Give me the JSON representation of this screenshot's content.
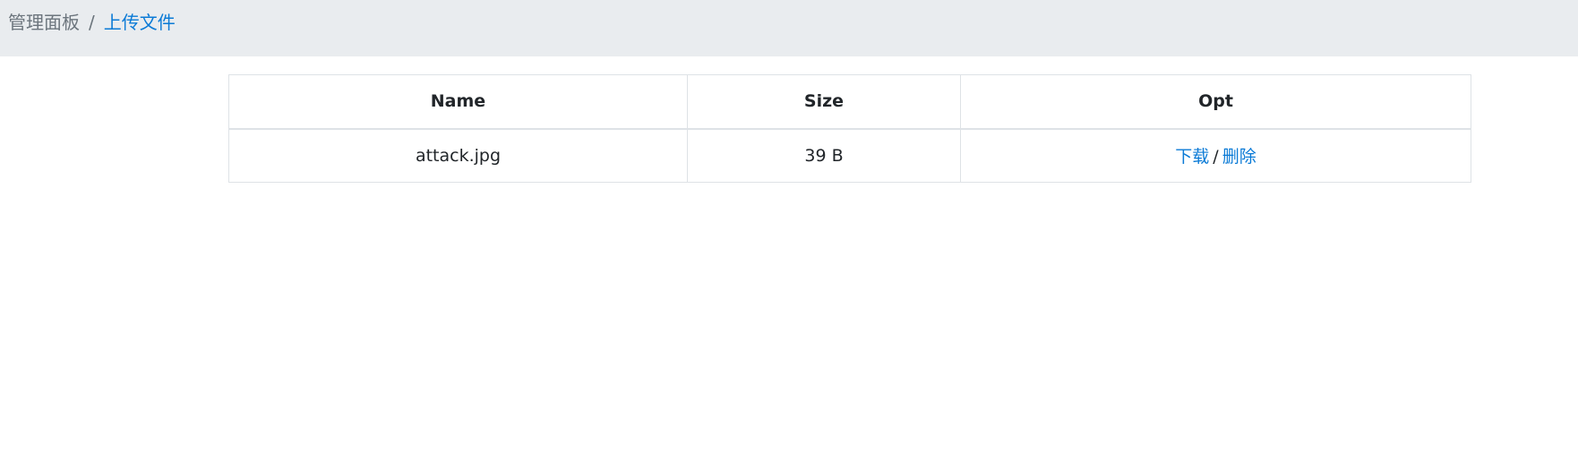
{
  "breadcrumb": {
    "home": "管理面板",
    "separator": "/",
    "current": "上传文件"
  },
  "table": {
    "headers": [
      "Name",
      "Size",
      "Opt"
    ],
    "rows": [
      {
        "name": "attack.jpg",
        "size": "39 B",
        "actions": {
          "download": "下载",
          "separator": "/",
          "delete": "删除"
        }
      }
    ]
  },
  "colors": {
    "breadcrumb_bg": "#e9ecef",
    "link": "#0a7ad6",
    "muted": "#6c757d",
    "border": "#dee2e6"
  }
}
